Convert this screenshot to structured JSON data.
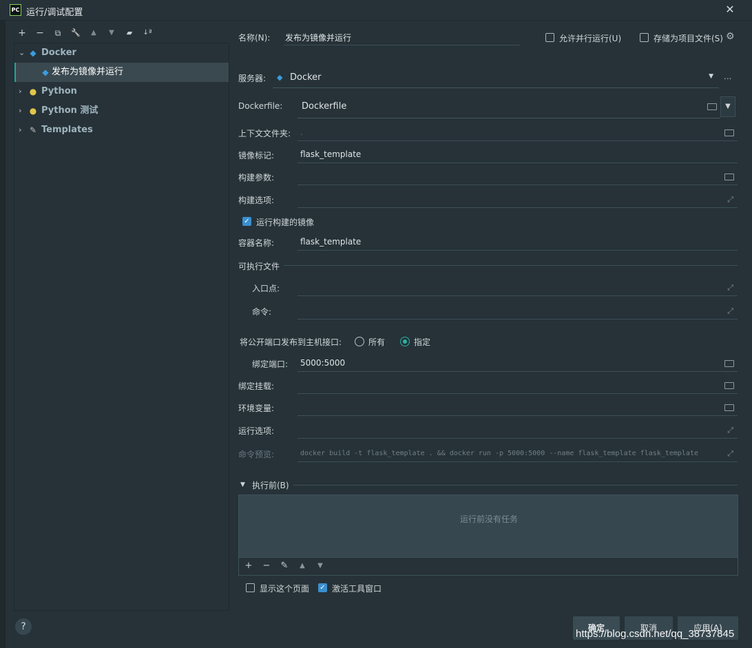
{
  "window": {
    "app_icon": "PC",
    "title": "运行/调试配置",
    "close": "✕"
  },
  "toolbar": {
    "add": "+",
    "remove": "−",
    "copy": "⧉",
    "edit": "🔧",
    "up": "▲",
    "down": "▼",
    "folder": "▰",
    "sort": "↓ª"
  },
  "tree": {
    "items": [
      {
        "label": "Docker",
        "icon": "docker-icon",
        "expanded": true
      },
      {
        "label": "发布为镜像并运行",
        "icon": "docker-icon",
        "selected": true
      },
      {
        "label": "Python",
        "icon": "python-icon",
        "expanded": false
      },
      {
        "label": "Python 测试",
        "icon": "python-test-icon",
        "expanded": false
      },
      {
        "label": "Templates",
        "icon": "wrench-icon",
        "expanded": false
      }
    ]
  },
  "header": {
    "name_label": "名称(N):",
    "name_value": "发布为镜像并运行",
    "allow_parallel": "允许并行运行(U)",
    "store_as_file": "存储为项目文件(S)"
  },
  "server": {
    "label": "服务器:",
    "value": "Docker",
    "more": "..."
  },
  "form": {
    "dockerfile_label": "Dockerfile:",
    "dockerfile_value": "Dockerfile",
    "context_label": "上下文文件夹:",
    "context_value": ".",
    "image_tag_label": "镜像标记:",
    "image_tag_value": "flask_template",
    "build_args_label": "构建参数:",
    "build_options_label": "构建选项:",
    "run_built_image": "运行构建的镜像",
    "container_name_label": "容器名称:",
    "container_name_value": "flask_template",
    "executable_section": "可执行文件",
    "entrypoint_label": "入口点:",
    "command_label": "命令:",
    "publish_ports_label": "将公开端口发布到主机接口:",
    "radio_all": "所有",
    "radio_specify": "指定",
    "bind_ports_label": "绑定端口:",
    "bind_ports_value": "5000:5000",
    "bind_mounts_label": "绑定挂载:",
    "env_vars_label": "环境变量:",
    "run_options_label": "运行选项:",
    "command_preview_label": "命令预览:",
    "command_preview_value": "docker build -t flask_template . && docker run -p 5000:5000 --name flask_template flask_template"
  },
  "before_launch": {
    "label": "执行前(B)",
    "empty": "运行前没有任务",
    "show_page": "显示这个页面",
    "activate_tool_window": "激活工具窗口"
  },
  "footer": {
    "help": "?",
    "ok": "确定",
    "cancel": "取消",
    "apply": "应用(A)",
    "watermark": "https://blog.csdn.net/qq_38737845"
  }
}
